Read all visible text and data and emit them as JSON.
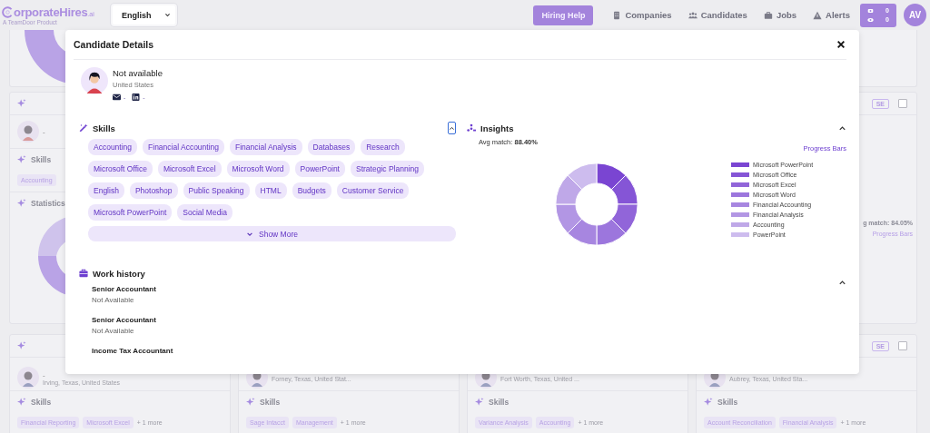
{
  "nav": {
    "logo": "orporateHires",
    "logo_suffix": ".ai",
    "tagline": "A TeamDoor Product",
    "language": "English",
    "hiring_help": "Hiring Help",
    "links": [
      {
        "label": "Companies",
        "kind": "building"
      },
      {
        "label": "Candidates",
        "kind": "people"
      },
      {
        "label": "Jobs",
        "kind": "briefcase"
      },
      {
        "label": "Alerts",
        "kind": "warning"
      }
    ],
    "counters": [
      "0",
      "0"
    ],
    "avatar": "AV"
  },
  "background": [
    {
      "mid": {
        "name": "-",
        "skills_label": "Skills",
        "tags": [
          "Accounting"
        ],
        "stats_label": "Statistics"
      },
      "bottom": {
        "name": "-",
        "location": "Irving, Texas, United States",
        "skills_label": "Skills",
        "tags": [
          "Financial Reporting",
          "Microsoft Excel"
        ],
        "more": "+ 1 more"
      }
    },
    {
      "bottom": {
        "location": "Forney, Texas, United Stat...",
        "skills_label": "Skills",
        "tags": [
          "Sage Intacct",
          "Management"
        ],
        "more": "+ 1 more"
      }
    },
    {
      "bottom": {
        "location": "Fort Worth, Texas, United ...",
        "skills_label": "Skills",
        "tags": [
          "Variance Analysis",
          "Accounting"
        ],
        "more": "+ 1 more"
      }
    },
    {
      "mid": {
        "badge": "SE",
        "checked": false,
        "match": "g match: 84.05%",
        "link": "Progress Bars"
      },
      "bottom": {
        "badge": "SE",
        "checked": false,
        "location": "Aubrey, Texas, United Sta...",
        "skills_label": "Skills",
        "tags": [
          "Account Reconciliation",
          "Financial Analysis"
        ],
        "more": "+ 1 more"
      }
    }
  ],
  "modal": {
    "title": "Candidate Details",
    "profile": {
      "name": "Not available",
      "location": "United States",
      "email": "-",
      "linkedin": "-"
    },
    "skills": {
      "title": "Skills",
      "expanded": true,
      "tags": [
        "Accounting",
        "Financial Accounting",
        "Financial Analysis",
        "Databases",
        "Research",
        "Microsoft Office",
        "Microsoft Excel",
        "Microsoft Word",
        "PowerPoint",
        "Strategic Planning",
        "English",
        "Photoshop",
        "Public Speaking",
        "HTML",
        "Budgets",
        "Customer Service",
        "Microsoft PowerPoint",
        "Social Media"
      ],
      "show_more": "Show More"
    },
    "insights": {
      "title": "Insights",
      "expanded": true,
      "avg": "Avg match: **88.40%**",
      "link": "Progress Bars",
      "legend": [
        {
          "label": "Microsoft PowerPoint",
          "color": "#7a45d2"
        },
        {
          "label": "Microsoft Office",
          "color": "#8555d6"
        },
        {
          "label": "Microsoft Excel",
          "color": "#9165d9"
        },
        {
          "label": "Microsoft Word",
          "color": "#9c76dd"
        },
        {
          "label": "Financial Accounting",
          "color": "#a786e0"
        },
        {
          "label": "Financial Analysis",
          "color": "#b296e4"
        },
        {
          "label": "Accounting",
          "color": "#bfa8e8"
        },
        {
          "label": "PowerPoint",
          "color": "#cdbcee"
        }
      ]
    },
    "work_history": {
      "title": "Work history",
      "expanded": true,
      "jobs": [
        {
          "title": "Senior Accountant",
          "company": "Not Available"
        },
        {
          "title": "Senior Accountant",
          "company": "Not Available"
        },
        {
          "title": "Income Tax Accountant"
        }
      ]
    }
  }
}
